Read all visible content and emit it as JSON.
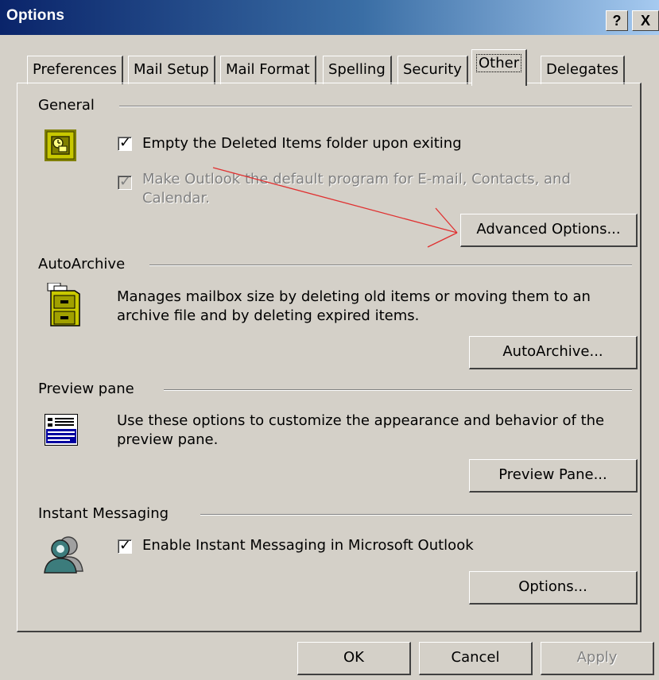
{
  "window": {
    "title": "Options",
    "help_glyph": "?",
    "close_glyph": "X"
  },
  "tabs": [
    {
      "label": "Preferences"
    },
    {
      "label": "Mail Setup"
    },
    {
      "label": "Mail Format"
    },
    {
      "label": "Spelling"
    },
    {
      "label": "Security"
    },
    {
      "label": "Other",
      "active": true
    },
    {
      "label": "Delegates"
    }
  ],
  "general": {
    "title": "General",
    "empty_deleted": {
      "label": "Empty the Deleted Items folder upon exiting",
      "checked": true
    },
    "default_program": {
      "label": "Make Outlook the default program for E-mail, Contacts, and Calendar.",
      "checked": true,
      "disabled": true
    },
    "advanced_button": "Advanced Options..."
  },
  "autoarchive": {
    "title": "AutoArchive",
    "description": "Manages mailbox size by deleting old items or moving them to an archive file and by deleting expired items.",
    "button": "AutoArchive..."
  },
  "preview": {
    "title": "Preview pane",
    "description": "Use these options to customize the appearance and behavior of the preview pane.",
    "button": "Preview Pane..."
  },
  "im": {
    "title": "Instant Messaging",
    "enable": {
      "label": "Enable Instant Messaging in Microsoft Outlook",
      "checked": true
    },
    "button": "Options..."
  },
  "footer": {
    "ok": "OK",
    "cancel": "Cancel",
    "apply": "Apply"
  },
  "colors": {
    "titlebar": "#0a246a",
    "face": "#d4d0c8",
    "arrow": "#e03030"
  }
}
